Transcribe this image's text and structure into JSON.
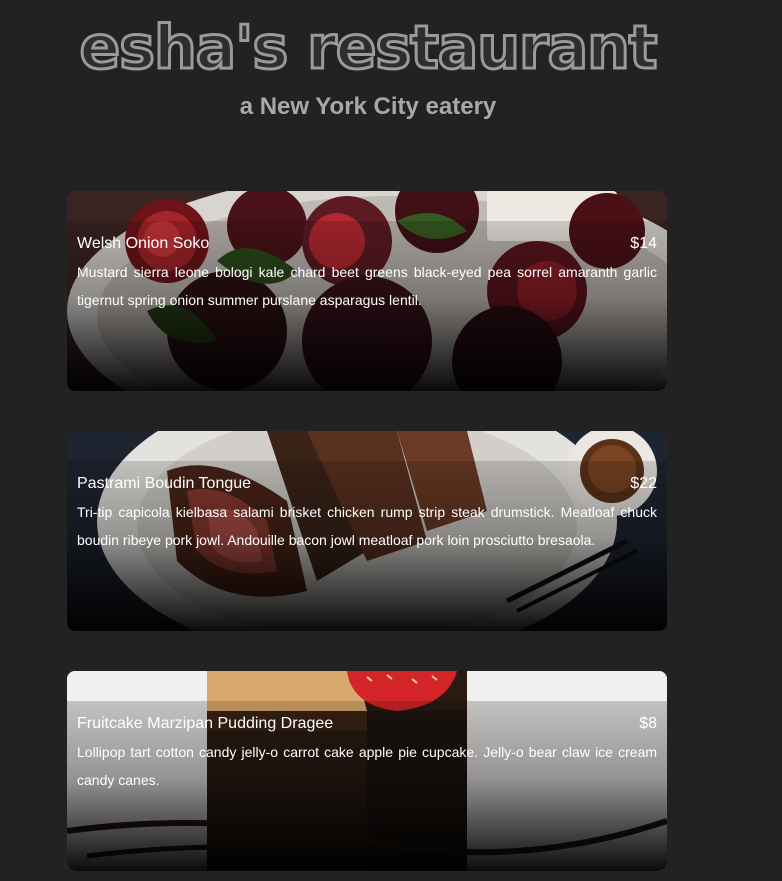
{
  "header": {
    "title": "esha's restaurant",
    "subtitle": "a New York City eatery"
  },
  "menu": [
    {
      "name": "Welsh Onion Soko",
      "price": "$14",
      "description": "Mustard sierra leone bologi kale chard beet greens black-eyed pea sorrel amaranth garlic tigernut spring onion summer purslane asparagus lentil.",
      "image": "roasted-beets-photo"
    },
    {
      "name": "Pastrami Boudin Tongue",
      "price": "$22",
      "description": "Tri-tip capicola kielbasa salami brisket chicken rump strip steak drumstick. Meatloaf chuck boudin ribeye pork jowl. Andouille bacon jowl meatloaf pork loin prosciutto bresaola.",
      "image": "sliced-steak-photo"
    },
    {
      "name": "Fruitcake Marzipan Pudding Dragee",
      "price": "$8",
      "description": "Lollipop tart cotton candy jelly-o carrot cake apple pie cupcake. Jelly-o bear claw ice cream candy canes.",
      "image": "chocolate-cake-photo"
    }
  ],
  "colors": {
    "page_background": "#222222",
    "title_stroke": "#9a9a9a",
    "subtitle": "#a8a8a8",
    "card_text": "#ffffff"
  }
}
